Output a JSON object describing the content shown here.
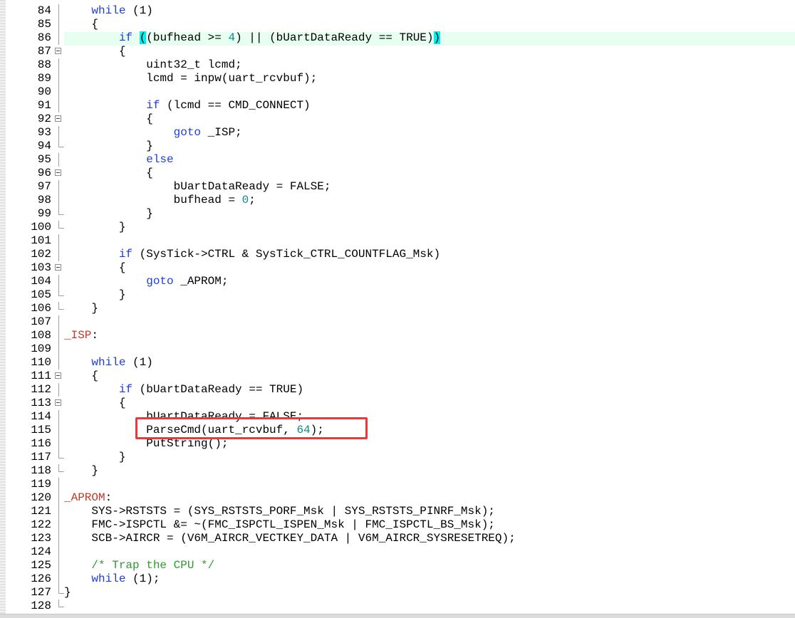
{
  "lines": [
    {
      "n": "84",
      "fold": "line",
      "code": "    <kw>while</kw> (1)"
    },
    {
      "n": "85",
      "fold": "line",
      "code": "    {"
    },
    {
      "n": "86",
      "fold": "line",
      "code": "        <kw>if</kw> <bm>(</bm>(bufhead >= <num>4</num>) || (bUartDataReady == TRUE)<bm>)</bm>",
      "current": true
    },
    {
      "n": "87",
      "fold": "box",
      "code": "        {"
    },
    {
      "n": "88",
      "fold": "line",
      "code": "            uint32_t lcmd;"
    },
    {
      "n": "89",
      "fold": "line",
      "code": "            lcmd = inpw(uart_rcvbuf);"
    },
    {
      "n": "90",
      "fold": "line",
      "code": ""
    },
    {
      "n": "91",
      "fold": "line",
      "code": "            <kw>if</kw> (lcmd == CMD_CONNECT)"
    },
    {
      "n": "92",
      "fold": "box",
      "code": "            {"
    },
    {
      "n": "93",
      "fold": "line",
      "code": "                <kw>goto</kw> _ISP;"
    },
    {
      "n": "94",
      "fold": "end",
      "code": "            }"
    },
    {
      "n": "95",
      "fold": "line",
      "code": "            <kw>else</kw>"
    },
    {
      "n": "96",
      "fold": "box",
      "code": "            {"
    },
    {
      "n": "97",
      "fold": "line",
      "code": "                bUartDataReady = FALSE;"
    },
    {
      "n": "98",
      "fold": "line",
      "code": "                bufhead = <num>0</num>;"
    },
    {
      "n": "99",
      "fold": "end",
      "code": "            }"
    },
    {
      "n": "100",
      "fold": "end",
      "code": "        }"
    },
    {
      "n": "101",
      "fold": "line",
      "code": ""
    },
    {
      "n": "102",
      "fold": "line",
      "code": "        <kw>if</kw> (SysTick->CTRL & SysTick_CTRL_COUNTFLAG_Msk)"
    },
    {
      "n": "103",
      "fold": "box",
      "code": "        {"
    },
    {
      "n": "104",
      "fold": "line",
      "code": "            <kw>goto</kw> _APROM;"
    },
    {
      "n": "105",
      "fold": "end",
      "code": "        }"
    },
    {
      "n": "106",
      "fold": "end",
      "code": "    }"
    },
    {
      "n": "107",
      "fold": "line",
      "code": ""
    },
    {
      "n": "108",
      "fold": "line",
      "code": "<lbl>_ISP</lbl>:"
    },
    {
      "n": "109",
      "fold": "line",
      "code": ""
    },
    {
      "n": "110",
      "fold": "line",
      "code": "    <kw>while</kw> (1)"
    },
    {
      "n": "111",
      "fold": "box",
      "code": "    {"
    },
    {
      "n": "112",
      "fold": "line",
      "code": "        <kw>if</kw> (bUartDataReady == TRUE)"
    },
    {
      "n": "113",
      "fold": "box",
      "code": "        {"
    },
    {
      "n": "114",
      "fold": "line",
      "code": "            bUartDataReady = FALSE;"
    },
    {
      "n": "115",
      "fold": "line",
      "code": "            ParseCmd(uart_rcvbuf, <num>64</num>);"
    },
    {
      "n": "116",
      "fold": "line",
      "code": "            PutString();"
    },
    {
      "n": "117",
      "fold": "end",
      "code": "        }"
    },
    {
      "n": "118",
      "fold": "end",
      "code": "    }"
    },
    {
      "n": "119",
      "fold": "line",
      "code": ""
    },
    {
      "n": "120",
      "fold": "line",
      "code": "<lbl>_APROM</lbl>:"
    },
    {
      "n": "121",
      "fold": "line",
      "code": "    SYS->RSTSTS = (SYS_RSTSTS_PORF_Msk | SYS_RSTSTS_PINRF_Msk);"
    },
    {
      "n": "122",
      "fold": "line",
      "code": "    FMC->ISPCTL &= ~(FMC_ISPCTL_ISPEN_Msk | FMC_ISPCTL_BS_Msk);"
    },
    {
      "n": "123",
      "fold": "line",
      "code": "    SCB->AIRCR = (V6M_AIRCR_VECTKEY_DATA | V6M_AIRCR_SYSRESETREQ);"
    },
    {
      "n": "124",
      "fold": "line",
      "code": ""
    },
    {
      "n": "125",
      "fold": "line",
      "code": "    <cm>/* Trap the CPU */</cm>"
    },
    {
      "n": "126",
      "fold": "line",
      "code": "    <kw>while</kw> (1);"
    },
    {
      "n": "127",
      "fold": "end",
      "code": "}"
    },
    {
      "n": "128",
      "fold": "end",
      "code": ""
    }
  ],
  "colors": {
    "keyword": "#1e3dde",
    "number": "#0a8a8a",
    "comment": "#2f9a2f",
    "label": "#c0392b",
    "current_line": "#e6fff0",
    "highlight_box": "#e53b3b"
  }
}
